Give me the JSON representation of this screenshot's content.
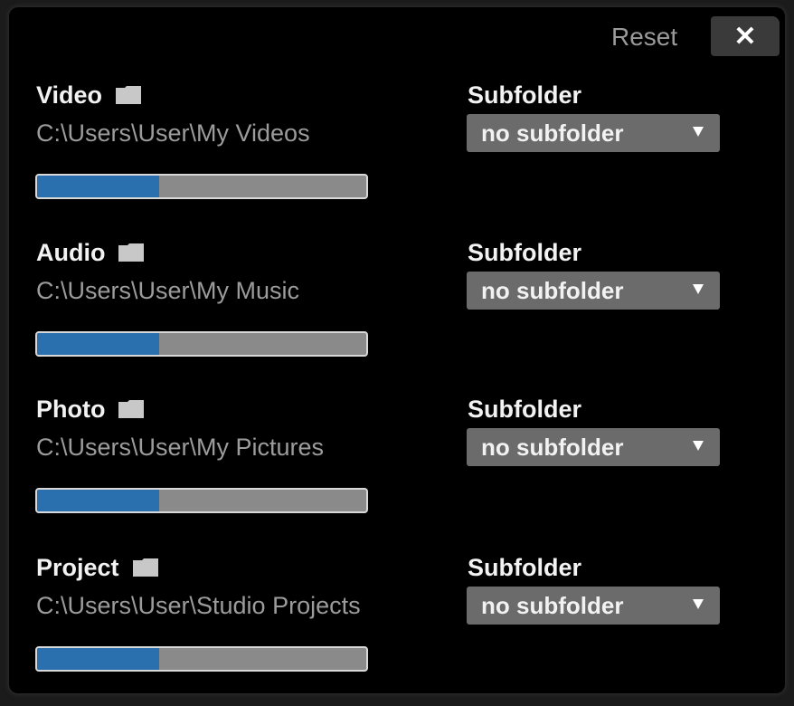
{
  "header": {
    "reset_label": "Reset",
    "close_symbol": "✕"
  },
  "colors": {
    "panel_background": "#000000",
    "progress_fill": "#2a6fae",
    "progress_track": "#8a8a8a",
    "dropdown_background": "#6b6b6b"
  },
  "sections": [
    {
      "title": "Video",
      "icon": "folder-icon",
      "path": "C:\\Users\\User\\My Videos",
      "subfolder_label": "Subfolder",
      "subfolder_value": "no subfolder",
      "progress_percent": 37
    },
    {
      "title": "Audio",
      "icon": "folder-icon",
      "path": "C:\\Users\\User\\My Music",
      "subfolder_label": "Subfolder",
      "subfolder_value": "no subfolder",
      "progress_percent": 37
    },
    {
      "title": "Photo",
      "icon": "folder-icon",
      "path": "C:\\Users\\User\\My Pictures",
      "subfolder_label": "Subfolder",
      "subfolder_value": "no subfolder",
      "progress_percent": 37
    },
    {
      "title": "Project",
      "icon": "folder-icon",
      "path": "C:\\Users\\User\\Studio Projects",
      "subfolder_label": "Subfolder",
      "subfolder_value": "no subfolder",
      "progress_percent": 37
    }
  ]
}
